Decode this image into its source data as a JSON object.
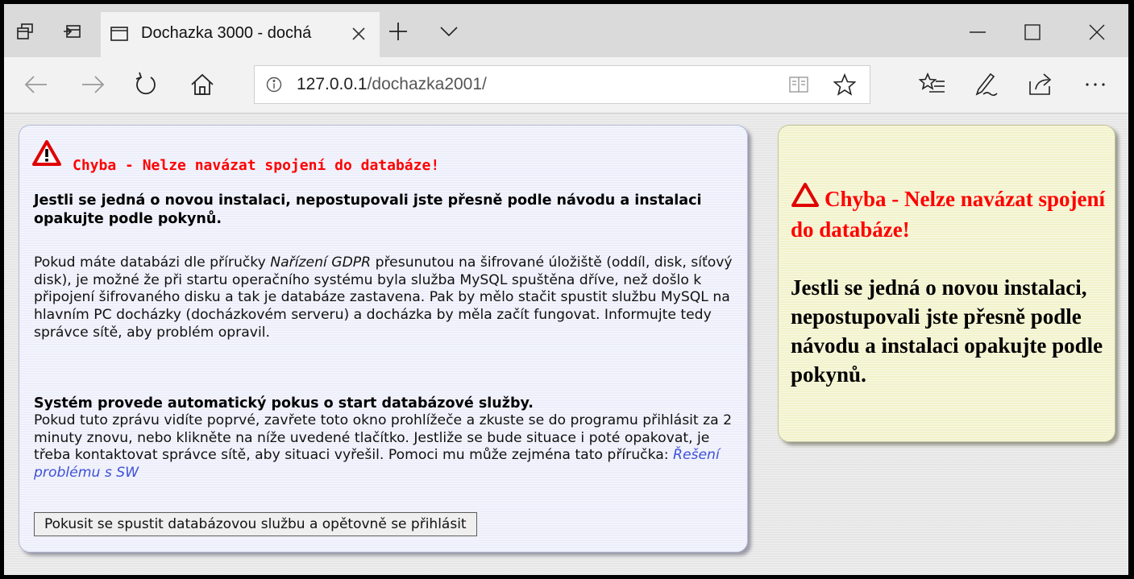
{
  "browser": {
    "tab": {
      "title": "Dochazka 3000 - dochá"
    },
    "address": {
      "host": "127.0.0.1",
      "path": "/dochazka2001/"
    },
    "icons": [
      "tab-set-aside-icon",
      "tabs-restore-icon",
      "page-icon",
      "close-tab-icon",
      "new-tab-icon",
      "tab-list-chevron-icon",
      "minimize-icon",
      "maximize-icon",
      "close-window-icon",
      "back-icon",
      "forward-icon",
      "refresh-icon",
      "home-icon",
      "site-info-icon",
      "reading-view-icon",
      "favorite-star-icon",
      "favorites-hub-icon",
      "web-note-icon",
      "share-icon",
      "more-icon"
    ]
  },
  "error_panel": {
    "heading": "Chyba - Nelze navázat spojení do databáze!",
    "subheading": "Jestli se jedná o novou instalaci, nepostupovali jste přesně podle návodu a instalaci opakujte podle pokynů.",
    "paragraph_before": "Pokud máte databázi dle příručky ",
    "paragraph_italic": "Nařízení GDPR",
    "paragraph_after": " přesunutou na šifrované úložiště (oddíl, disk, síťový disk), je možné že při startu operačního systému byla služba MySQL spuštěna dříve, než došlo k připojení šifrovaného disku a tak je databáze zastavena. Pak by mělo stačit spustit službu MySQL na hlavním PC docházky (docházkovém serveru) a docházka by měla začít fungovat. Informujte tedy správce sítě, aby problém opravil.",
    "auto_title": "Systém provede automatický pokus o start databázové služby.",
    "auto_text": "Pokud tuto zprávu vidíte poprvé, zavřete toto okno prohlížeče a zkuste se do programu přihlásit za 2 minuty znovu, nebo klikněte na níže uvedené tlačítko. Jestliže se bude situace i poté opakovat, je třeba kontaktovat správce sítě, aby situaci vyřešil. Pomoci mu může zejména tato příručka: ",
    "link_text": "Řešení problému s SW",
    "button_label": "Pokusit se spustit databázovou službu a opětovně se přihlásit"
  },
  "side_panel": {
    "heading": "Chyba - Nelze navázat spojení do databáze!",
    "text": "Jestli se jedná o novou instalaci, nepostupovali jste přesně podle návodu a instalaci opakujte podle pokynů."
  },
  "colors": {
    "error_red": "#ff0000",
    "link_blue": "#3f51d6",
    "left_panel_bg": "#eceefa",
    "right_panel_bg": "#f2f2cc"
  }
}
